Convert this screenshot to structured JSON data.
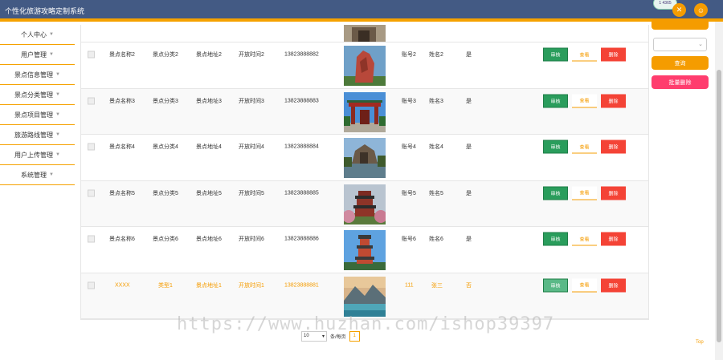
{
  "header": {
    "title": "个性化旅游攻略定制系统",
    "badge_text": "1 4365"
  },
  "sidebar": {
    "items": [
      {
        "label": "个人中心"
      },
      {
        "label": "用户管理"
      },
      {
        "label": "景点信息管理"
      },
      {
        "label": "景点分类管理"
      },
      {
        "label": "景点项目管理"
      },
      {
        "label": "旅游路线管理"
      },
      {
        "label": "用户上传管理"
      },
      {
        "label": "系统管理"
      }
    ]
  },
  "table": {
    "rows": [
      {
        "name": "景点名称2",
        "category": "景点分类2",
        "address": "景点地址2",
        "hours": "开放时间2",
        "phone": "13823888882",
        "account": "账号2",
        "realname": "姓名2",
        "audit": "是",
        "img": "rock"
      },
      {
        "name": "景点名称3",
        "category": "景点分类3",
        "address": "景点地址3",
        "hours": "开放时间3",
        "phone": "13823888883",
        "account": "账号3",
        "realname": "姓名3",
        "audit": "是",
        "img": "gate"
      },
      {
        "name": "景点名称4",
        "category": "景点分类4",
        "address": "景点地址4",
        "hours": "开放时间4",
        "phone": "13823888884",
        "account": "账号4",
        "realname": "姓名4",
        "audit": "是",
        "img": "lake"
      },
      {
        "name": "景点名称5",
        "category": "景点分类5",
        "address": "景点地址5",
        "hours": "开放时间5",
        "phone": "13823888885",
        "account": "账号5",
        "realname": "姓名5",
        "audit": "是",
        "img": "pagoda"
      },
      {
        "name": "景点名称6",
        "category": "景点分类6",
        "address": "景点地址6",
        "hours": "开放时间6",
        "phone": "13823888886",
        "account": "账号6",
        "realname": "姓名6",
        "audit": "是",
        "img": "tower"
      },
      {
        "name": "XXXX",
        "category": "类型1",
        "address": "景点地址1",
        "hours": "开放时间1",
        "phone": "13823888881",
        "account": "111",
        "realname": "张三",
        "audit": "否",
        "img": "mountain"
      }
    ],
    "buttons": {
      "audit": "审核",
      "view": "查看",
      "delete": "删除"
    }
  },
  "right_panel": {
    "query_label": "查询",
    "batch_delete_label": "批量删除",
    "select_value": ""
  },
  "pagination": {
    "page_size": "10",
    "per_page_suffix": "条/每页",
    "current_page": "1"
  },
  "watermark": "https://www.huzhan.com/ishop39397",
  "top_link": "Top",
  "colors": {
    "accent": "#f5a100",
    "header": "#435a84",
    "audit": "#2a9d5c",
    "delete": "#f44336",
    "batch_delete": "#ff3d6e"
  }
}
